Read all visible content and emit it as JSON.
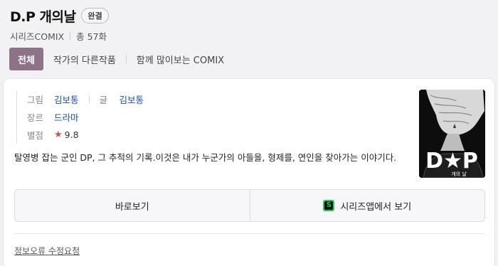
{
  "header": {
    "title": "D.P 개의날",
    "badge": "완결",
    "series_name": "시리즈COMIX",
    "episode_count": "총 57화"
  },
  "tabs": [
    {
      "label": "전체",
      "active": true
    },
    {
      "label": "작가의 다른작품",
      "active": false
    },
    {
      "label": "함께 많이보는 COMIX",
      "active": false
    }
  ],
  "info": {
    "art_label": "그림",
    "art_value": "김보통",
    "story_label": "글",
    "story_value": "김보통",
    "genre_label": "장르",
    "genre_value": "드라마",
    "rating_label": "별점",
    "rating_icon": "star-icon",
    "rating_value": "9.8"
  },
  "description": "탈영병 잡는 군인 DP, 그 추적의 기록.이것은 내가 누군가의 아들을, 형제를, 연인을 찾아가는 이야기다.",
  "cover": {
    "title_text": "D★P",
    "subtitle_text": "개의 날"
  },
  "actions": {
    "read_label": "바로보기",
    "app_label": "시리즈앱에서 보기",
    "app_icon": "series-app-icon",
    "app_icon_letter": "S"
  },
  "footer": {
    "report_label": "정보오류 수정요청"
  },
  "colors": {
    "accent": "#8e7288",
    "link": "#1a4fa3",
    "star": "#e04a4a",
    "app_green": "#1fcf4f"
  }
}
